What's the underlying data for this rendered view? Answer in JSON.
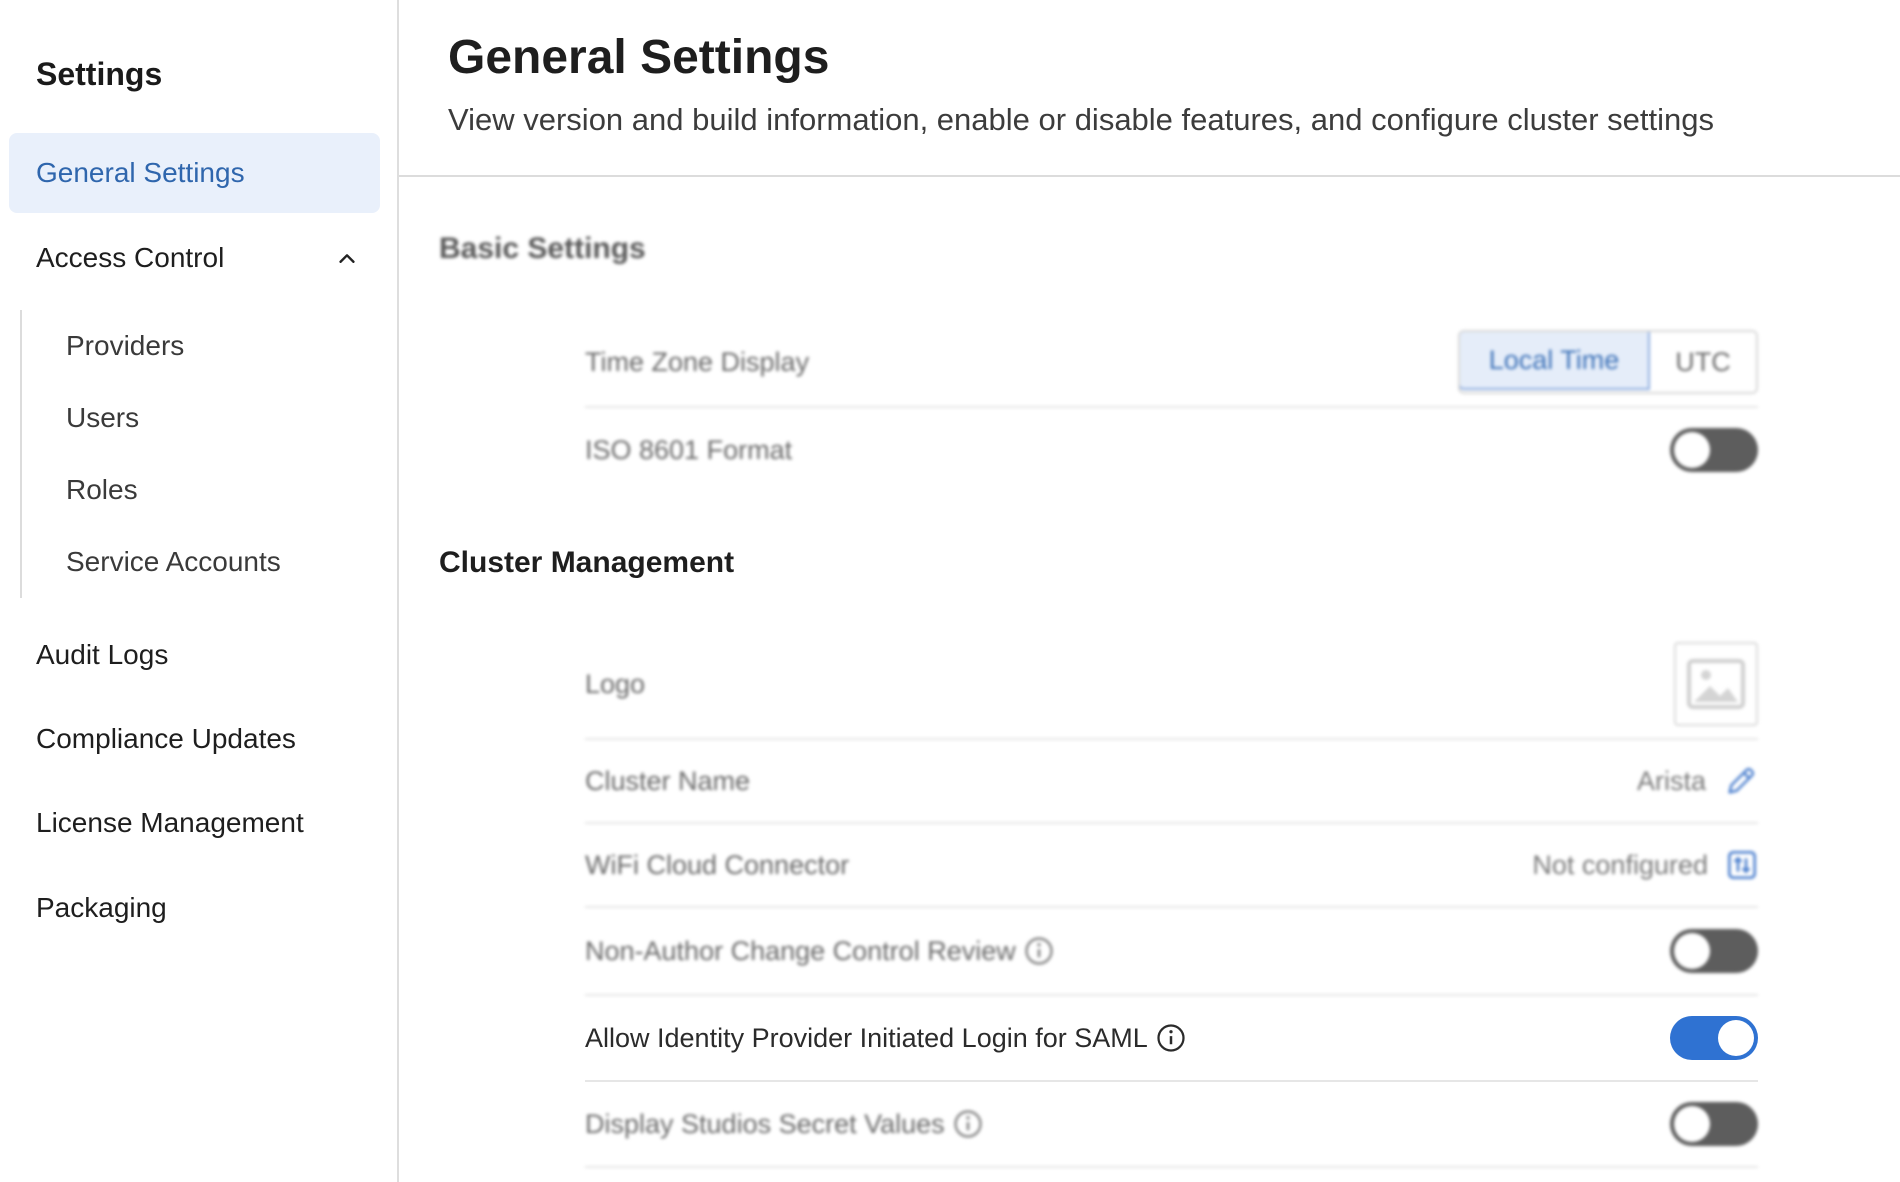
{
  "sidebar": {
    "title": "Settings",
    "items": [
      {
        "label": "General Settings"
      },
      {
        "label": "Access Control"
      },
      {
        "label": "Audit Logs"
      },
      {
        "label": "Compliance Updates"
      },
      {
        "label": "License Management"
      },
      {
        "label": "Packaging"
      }
    ],
    "access_control_children": [
      {
        "label": "Providers"
      },
      {
        "label": "Users"
      },
      {
        "label": "Roles"
      },
      {
        "label": "Service Accounts"
      }
    ]
  },
  "header": {
    "title": "General Settings",
    "subtitle": "View version and build information, enable or disable features, and configure cluster settings"
  },
  "basic_settings": {
    "title": "Basic Settings",
    "time_zone": {
      "label": "Time Zone Display",
      "options": [
        "Local Time",
        "UTC"
      ],
      "selected": "Local Time"
    },
    "iso_format": {
      "label": "ISO 8601 Format",
      "enabled": false
    }
  },
  "cluster_management": {
    "title": "Cluster Management",
    "logo": {
      "label": "Logo",
      "icon": "image-placeholder-icon"
    },
    "cluster_name": {
      "label": "Cluster Name",
      "value": "Arista",
      "icon": "pencil-icon"
    },
    "wifi_connector": {
      "label": "WiFi Cloud Connector",
      "value": "Not configured",
      "icon": "configure-icon"
    },
    "change_control": {
      "label": "Non-Author Change Control Review",
      "enabled": false
    },
    "saml_login": {
      "label": "Allow Identity Provider Initiated Login for SAML",
      "enabled": true
    },
    "secret_values": {
      "label": "Display Studios Secret Values",
      "enabled": false
    }
  },
  "colors": {
    "accent": "#2f72d2",
    "active_nav_bg": "#e9f0fb",
    "active_nav_text": "#2f66ad",
    "toggle_off": "#5d5d5d"
  }
}
